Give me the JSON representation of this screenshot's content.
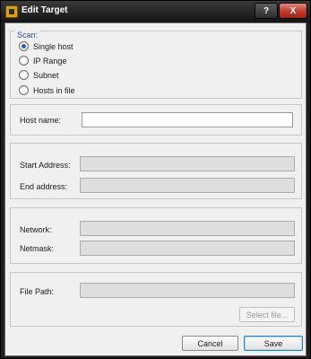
{
  "window": {
    "title": "Edit Target",
    "help_label": "?",
    "close_label": "X"
  },
  "scan": {
    "title": "Scan:",
    "options": [
      {
        "label": "Single host",
        "checked": true
      },
      {
        "label": "IP Range",
        "checked": false
      },
      {
        "label": "Subnet",
        "checked": false
      },
      {
        "label": "Hosts in file",
        "checked": false
      }
    ]
  },
  "host": {
    "label": "Host name:",
    "value": ""
  },
  "range": {
    "start_label": "Start Address:",
    "end_label": "End address:",
    "start_value": "",
    "end_value": ""
  },
  "subnet": {
    "network_label": "Network:",
    "netmask_label": "Netmask:",
    "network_value": "",
    "netmask_value": ""
  },
  "file": {
    "path_label": "File Path:",
    "path_value": "",
    "select_label": "Select file..."
  },
  "footer": {
    "cancel_label": "Cancel",
    "save_label": "Save"
  }
}
